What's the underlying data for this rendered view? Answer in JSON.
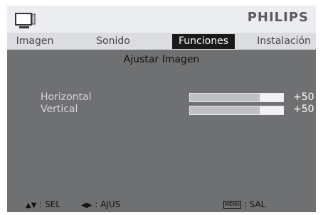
{
  "header": {
    "brand": "PHILIPS",
    "icon": "tv-icon"
  },
  "tabs": [
    {
      "label": "Imagen",
      "active": false
    },
    {
      "label": "Sonido",
      "active": false
    },
    {
      "label": "Funciones",
      "active": true
    },
    {
      "label": "Instalación",
      "active": false
    }
  ],
  "main": {
    "title": "Ajustar Imagen",
    "settings": [
      {
        "label": "Horizontal",
        "value": "+50",
        "level": 0.75
      },
      {
        "label": "Vertical",
        "value": "+50",
        "level": 0.75
      }
    ]
  },
  "footer": {
    "select_glyph": "▲▼",
    "select_label": ": SEL",
    "adjust_glyph": "◀▶",
    "adjust_label": ": AJUS",
    "menu_key": "MENU",
    "exit_label": ": SAL"
  },
  "colors": {
    "accent_tab": "#1a1a1a",
    "panel": "#6f7072",
    "header": "#ecedf0"
  }
}
